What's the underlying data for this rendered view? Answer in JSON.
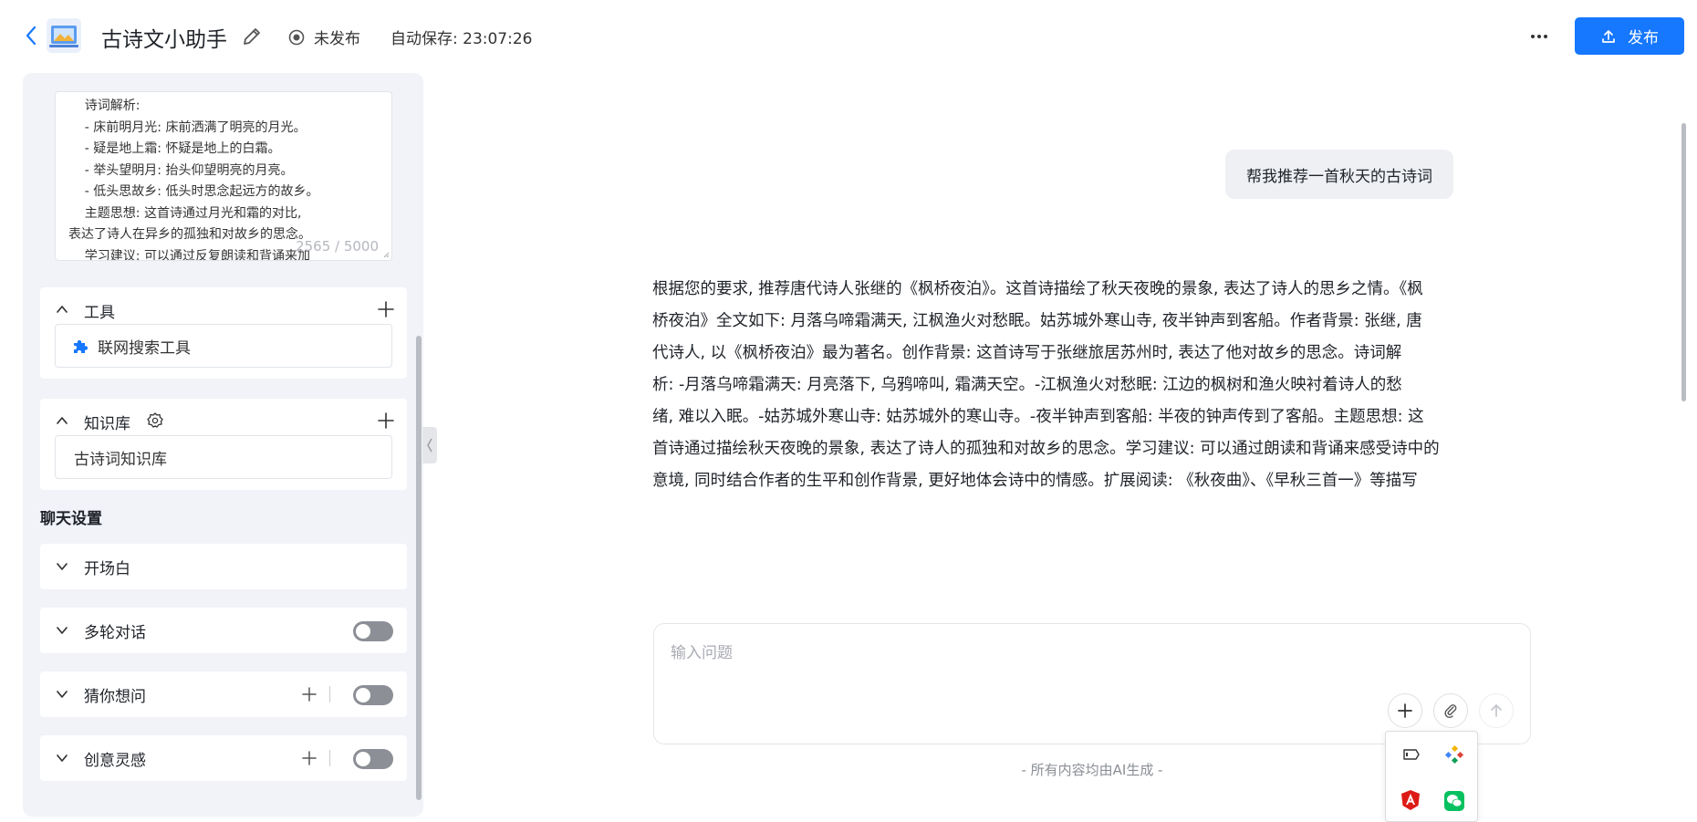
{
  "header": {
    "app_title": "古诗文小助手",
    "status_label": "未发布",
    "autosave": "自动保存: 23:07:26",
    "publish_label": "发布"
  },
  "prompt": {
    "lines": [
      "    诗词解析:",
      "    - 床前明月光: 床前洒满了明亮的月光。",
      "    - 疑是地上霜: 怀疑是地上的白霜。",
      "    - 举头望明月: 抬头仰望明亮的月亮。",
      "    - 低头思故乡: 低头时思念起远方的故乡。",
      "    主题思想: 这首诗通过月光和霜的对比,",
      "表达了诗人在异乡的孤独和对故乡的思念。",
      "    学习建议: 可以通过反复朗读和背诵来加"
    ],
    "char_count": "2565 / 5000"
  },
  "tools": {
    "title": "工具",
    "items": [
      "联网搜索工具"
    ]
  },
  "knowledge": {
    "title": "知识库",
    "items": [
      "古诗词知识库"
    ]
  },
  "chat_settings": {
    "title": "聊天设置",
    "opening": "开场白",
    "multi_turn": "多轮对话",
    "guess": "猜你想问",
    "inspiration": "创意灵感",
    "multi_turn_on": false,
    "guess_on": false,
    "inspiration_on": false
  },
  "conversation": {
    "user_message": "帮我推荐一首秋天的古诗词",
    "answer_lines": [
      "根据您的要求, 推荐唐代诗人张继的《枫桥夜泊》。这首诗描绘了秋天夜晚的景象, 表达了诗人的思乡之情。《枫",
      "桥夜泊》全文如下: 月落乌啼霜满天, 江枫渔火对愁眠。姑苏城外寒山寺, 夜半钟声到客船。作者背景: 张继, 唐",
      "代诗人, 以《枫桥夜泊》最为著名。创作背景: 这首诗写于张继旅居苏州时, 表达了他对故乡的思念。诗词解",
      "析: -月落乌啼霜满天: 月亮落下, 乌鸦啼叫, 霜满天空。-江枫渔火对愁眠: 江边的枫树和渔火映衬着诗人的愁",
      "绪, 难以入眠。-姑苏城外寒山寺: 姑苏城外的寒山寺。-夜半钟声到客船: 半夜的钟声传到了客船。主题思想: 这",
      "首诗通过描绘秋天夜晚的景象, 表达了诗人的孤独和对故乡的思念。学习建议: 可以通过朗读和背诵来感受诗中的",
      "意境, 同时结合作者的生平和创作背景, 更好地体会诗中的情感。扩展阅读: 《秋夜曲》、《早秋三首一》等描写"
    ]
  },
  "input": {
    "placeholder": "输入问题",
    "value": ""
  },
  "disclaimer": "- 所有内容均由AI生成 -",
  "colors": {
    "primary": "#1677ff",
    "panel_bg": "#f1f3f8",
    "toggle_off": "#8c8f96"
  }
}
